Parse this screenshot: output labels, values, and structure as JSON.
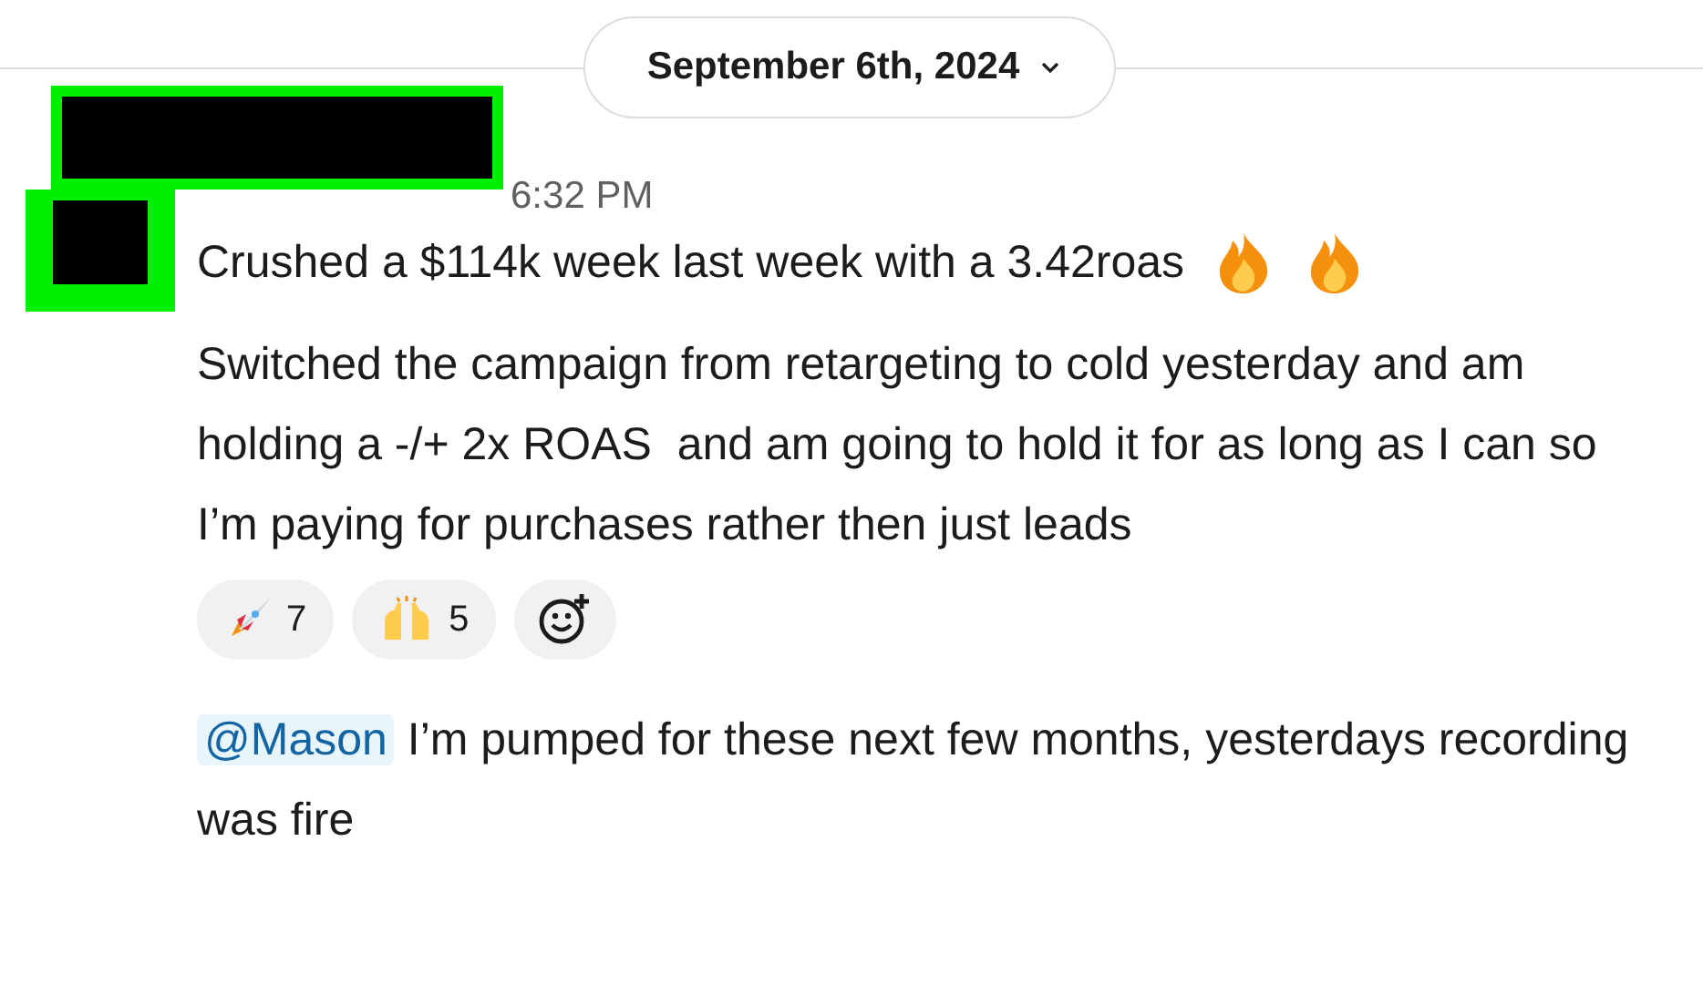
{
  "date_divider": {
    "label": "September 6th, 2024"
  },
  "message": {
    "time": "6:32 PM",
    "paragraphs": [
      "Crushed a $114k week last week with a 3.42roas",
      "Switched the campaign from retargeting to cold yesterday and am holding a -/+ 2x ROAS  and am going to hold it for as long as I can so I’m paying for purchases rather then just leads"
    ],
    "reactions": [
      {
        "count": "7",
        "selected": false
      },
      {
        "count": "5",
        "selected": false
      }
    ]
  },
  "reply": {
    "mention": "@Mason",
    "text": " I’m pumped for these next few months, yesterdays recording was fire"
  }
}
